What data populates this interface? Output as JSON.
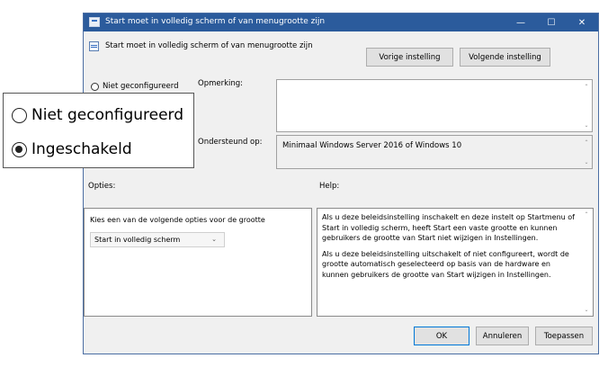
{
  "window": {
    "title": "Start moet in volledig scherm of van menugrootte zijn",
    "controls": {
      "minimize": "—",
      "maximize": "☐",
      "close": "✕"
    }
  },
  "header": {
    "setting_name": "Start moet in volledig scherm of van menugrootte zijn",
    "prev_button": "Vorige instelling",
    "next_button": "Volgende instelling"
  },
  "state": {
    "options": [
      {
        "label": "Niet geconfigureerd",
        "selected": false
      },
      {
        "label": "Ingeschakeld",
        "selected": true
      }
    ]
  },
  "comment": {
    "label": "Opmerking:",
    "value": ""
  },
  "supported": {
    "label": "Ondersteund op:",
    "value": "Minimaal Windows Server 2016 of Windows 10"
  },
  "options_panel": {
    "label": "Opties:",
    "description": "Kies een van de volgende opties voor de grootte",
    "dropdown_value": "Start in volledig scherm"
  },
  "help_panel": {
    "label": "Help:",
    "paragraphs": [
      "Als u deze beleidsinstelling inschakelt en deze instelt op Startmenu of Start in volledig scherm, heeft Start een vaste grootte en kunnen gebruikers de grootte van Start niet wijzigen in Instellingen.",
      "Als u deze beleidsinstelling uitschakelt of niet configureert, wordt de grootte automatisch geselecteerd op basis van de hardware en kunnen gebruikers de grootte van Start wijzigen in Instellingen."
    ]
  },
  "footer": {
    "ok": "OK",
    "cancel": "Annuleren",
    "apply": "Toepassen"
  },
  "zoom_callout": {
    "options": [
      {
        "label": "Niet geconfigureerd",
        "selected": false
      },
      {
        "label": "Ingeschakeld",
        "selected": true
      }
    ]
  }
}
